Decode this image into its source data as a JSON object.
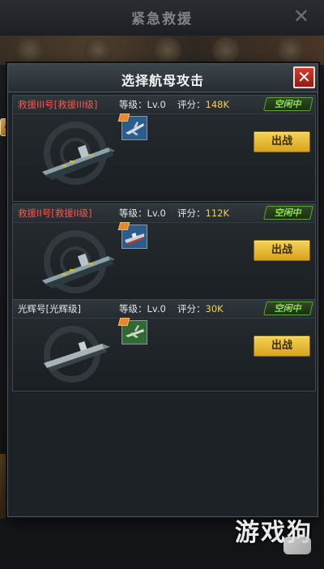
{
  "background": {
    "title": "紧急救援",
    "close": "✕"
  },
  "dialog": {
    "title": "选择航母攻击",
    "close": "✕"
  },
  "carriers": [
    {
      "name": "救援III号[救援III级]",
      "name_color": "#ef5a49",
      "level": "等级：Lv.0",
      "score_label": "评分：",
      "score": "148K",
      "status": "空闲中",
      "plane_icon": "fighter-jet-icon",
      "plane_color": "#2c5c8c",
      "fight": "出战"
    },
    {
      "name": "救援II号[救援II级]",
      "name_color": "#ef5a49",
      "level": "等级：Lv.0",
      "score_label": "评分：",
      "score": "112K",
      "status": "空闲中",
      "plane_icon": "warship-icon",
      "plane_color": "#2c5c8c",
      "fight": "出战"
    },
    {
      "name": "光辉号[光辉级]",
      "name_color": "#e3e6e8",
      "level": "等级：Lv.0",
      "score_label": "评分：",
      "score": "30K",
      "status": "空闲中",
      "plane_icon": "propeller-plane-icon",
      "plane_color": "#2f6a34",
      "fight": "出战"
    }
  ],
  "watermark": "游戏狗",
  "colors": {
    "accent_gold": "#f5d254",
    "status_green": "#8ee05a",
    "close_red": "#d63a2e"
  }
}
